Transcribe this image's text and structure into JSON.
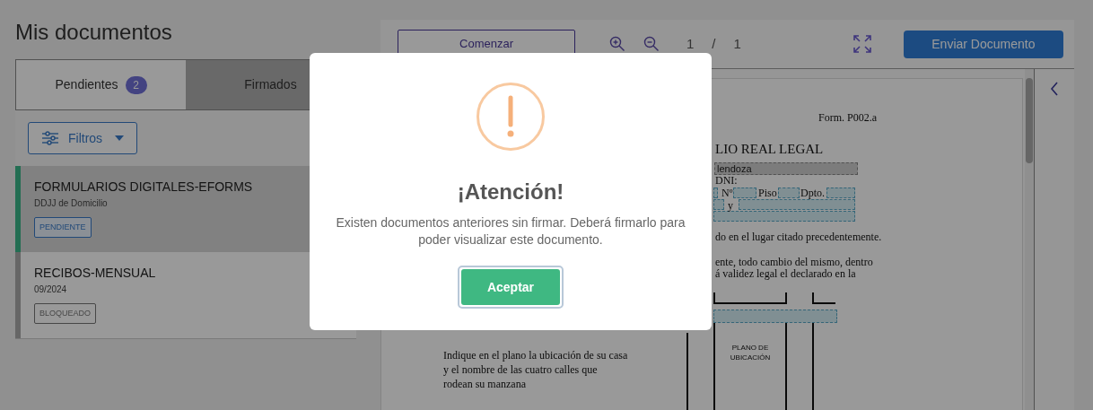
{
  "page_title": "Mis documentos",
  "tabs": [
    {
      "label": "Pendientes",
      "badge": "2",
      "selected": true
    },
    {
      "label": "Firmados",
      "selected": false
    }
  ],
  "filter_button": "Filtros",
  "documents": [
    {
      "title": "FORMULARIOS DIGITALES-EFORMS",
      "subtitle": "DDJJ de Domicilio",
      "status": "PENDIENTE",
      "kind": "pending",
      "selected": true
    },
    {
      "title": "RECIBOS-MENSUAL",
      "subtitle": "09/2024",
      "status": "BLOQUEADO",
      "kind": "blocked",
      "selected": false
    }
  ],
  "viewer": {
    "start_button": "Comenzar",
    "page_current": "1",
    "page_separator": "/",
    "page_total": "1",
    "send_button": "Enviar Documento",
    "document": {
      "form_code": "Form. P002.a",
      "heading": "LIO REAL LEGAL",
      "filled_value": "lendoza",
      "labels": [
        "DNI:",
        "Nº",
        "Piso",
        "Dpto.",
        "y"
      ],
      "lines_right": [
        "do en el lugar citado precedentemente.",
        "ente, todo cambio del mismo, dentro",
        "á validez legal el declarado en la"
      ],
      "lines_left": [
        "Indique en el plano la ubicación de su casa",
        "y el nombre de las cuatro calles que",
        "rodean su manzana"
      ],
      "map_label": "PLANO DE UBICACIÓN"
    }
  },
  "dialog": {
    "title": "¡Atención!",
    "message": "Existen documentos anteriores sin firmar. Deberá firmarlo para poder visualizar este documento.",
    "button": "Aceptar"
  }
}
